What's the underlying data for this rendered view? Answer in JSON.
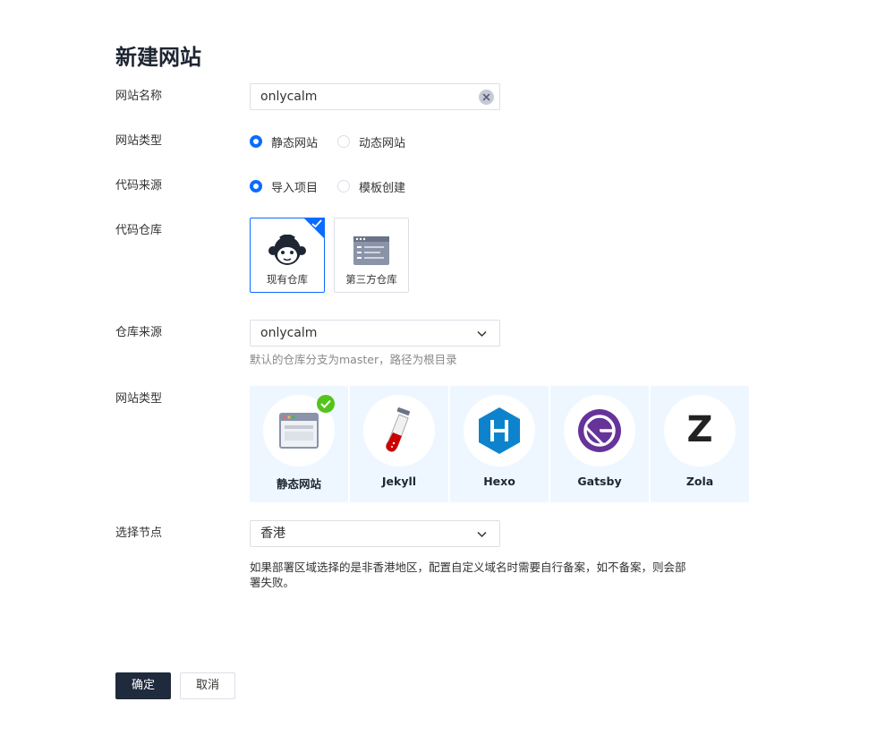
{
  "page": {
    "title": "新建网站"
  },
  "form": {
    "site_name": {
      "label": "网站名称",
      "value": "onlycalm"
    },
    "site_kind": {
      "label": "网站类型",
      "options": [
        "静态网站",
        "动态网站"
      ],
      "selected": "静态网站"
    },
    "code_source": {
      "label": "代码来源",
      "options": [
        "导入项目",
        "模板创建"
      ],
      "selected": "导入项目"
    },
    "code_repo": {
      "label": "代码仓库",
      "options": [
        "现有仓库",
        "第三方仓库"
      ],
      "selected": "现有仓库"
    },
    "repo_source": {
      "label": "仓库来源",
      "value": "onlycalm",
      "hint": "默认的仓库分支为master，路径为根目录"
    },
    "framework": {
      "label": "网站类型",
      "options": [
        "静态网站",
        "Jekyll",
        "Hexo",
        "Gatsby",
        "Zola"
      ],
      "selected": "静态网站",
      "zola_letter": "Z"
    },
    "node": {
      "label": "选择节点",
      "value": "香港",
      "note": "如果部署区域选择的是非香港地区，配置自定义域名时需要自行备案，如不备案，则会部署失败。"
    }
  },
  "actions": {
    "confirm": "确定",
    "cancel": "取消"
  },
  "colors": {
    "accent": "#0a6cff",
    "primary_button": "#1f2a3d",
    "card_bg": "#eef7ff",
    "check_green": "#52c41a"
  }
}
